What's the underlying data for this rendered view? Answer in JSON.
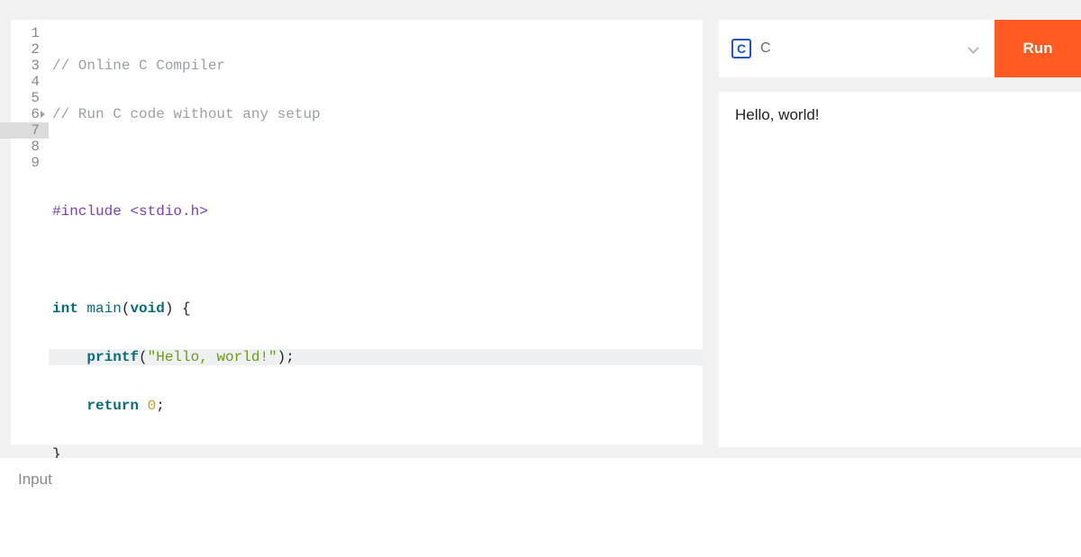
{
  "editor": {
    "lines": [
      {
        "n": "1"
      },
      {
        "n": "2"
      },
      {
        "n": "3"
      },
      {
        "n": "4"
      },
      {
        "n": "5"
      },
      {
        "n": "6"
      },
      {
        "n": "7"
      },
      {
        "n": "8"
      },
      {
        "n": "9"
      }
    ],
    "code": {
      "l1_comment": "// Online C Compiler",
      "l2_comment": "// Run C code without any setup",
      "l4_include": "#include",
      "l4_header": " <stdio.h>",
      "l6_int": "int",
      "l6_main": " main",
      "l6_paren_open": "(",
      "l6_void": "void",
      "l6_paren_close": ")",
      "l6_brace": " {",
      "l7_indent": "    ",
      "l7_printf": "printf",
      "l7_open": "(",
      "l7_str": "\"Hello, world!\"",
      "l7_close": ");",
      "l8_indent": "    ",
      "l8_return": "return",
      "l8_sp": " ",
      "l8_zero": "0",
      "l8_semi": ";",
      "l9_brace": "}"
    },
    "active_line": 7,
    "fold_line": 6
  },
  "controls": {
    "language_icon_letter": "C",
    "language_label": "C",
    "run_label": "Run"
  },
  "output": {
    "text": "Hello, world!"
  },
  "input_panel": {
    "label": "Input"
  }
}
